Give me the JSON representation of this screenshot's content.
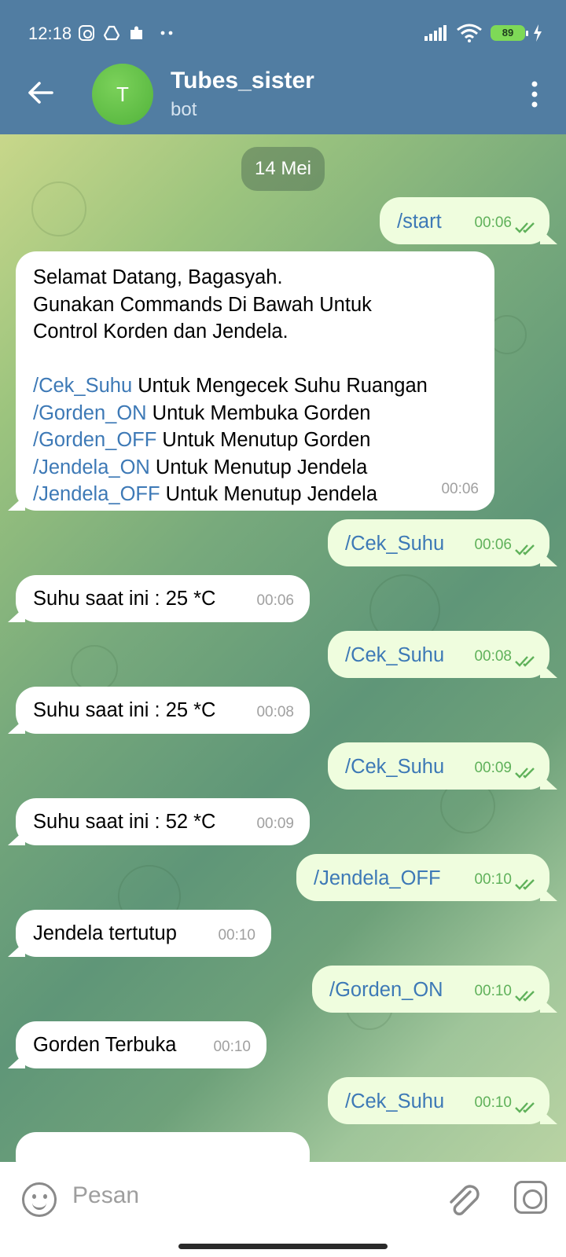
{
  "status_bar": {
    "time": "12:18",
    "battery": "89"
  },
  "header": {
    "avatar_letter": "T",
    "title": "Tubes_sister",
    "subtitle": "bot"
  },
  "date_chip": "14 Mei",
  "messages": {
    "m1": {
      "text": "/start",
      "time": "00:06"
    },
    "m2": {
      "intro": "Selamat Datang, Bagasyah.\nGunakan Commands Di Bawah Untuk\nControl Korden dan Jendela.",
      "commands": [
        {
          "cmd": "/Cek_Suhu",
          "desc": " Untuk Mengecek Suhu Ruangan"
        },
        {
          "cmd": "/Gorden_ON",
          "desc": " Untuk Membuka Gorden"
        },
        {
          "cmd": "/Gorden_OFF",
          "desc": " Untuk Menutup Gorden"
        },
        {
          "cmd": "/Jendela_ON",
          "desc": " Untuk Menutup Jendela"
        },
        {
          "cmd": "/Jendela_OFF",
          "desc": " Untuk Menutup Jendela"
        }
      ],
      "time": "00:06"
    },
    "m3": {
      "text": "/Cek_Suhu",
      "time": "00:06"
    },
    "m4": {
      "text": "Suhu saat ini : 25 *C",
      "time": "00:06"
    },
    "m5": {
      "text": "/Cek_Suhu",
      "time": "00:08"
    },
    "m6": {
      "text": "Suhu saat ini : 25 *C",
      "time": "00:08"
    },
    "m7": {
      "text": "/Cek_Suhu",
      "time": "00:09"
    },
    "m8": {
      "text": "Suhu saat ini : 52 *C",
      "time": "00:09"
    },
    "m9": {
      "text": "/Jendela_OFF",
      "time": "00:10"
    },
    "m10": {
      "text": "Jendela tertutup",
      "time": "00:10"
    },
    "m11": {
      "text": "/Gorden_ON",
      "time": "00:10"
    },
    "m12": {
      "text": "Gorden Terbuka",
      "time": "00:10"
    },
    "m13": {
      "text": "/Cek_Suhu",
      "time": "00:10"
    }
  },
  "input": {
    "placeholder": "Pesan"
  }
}
